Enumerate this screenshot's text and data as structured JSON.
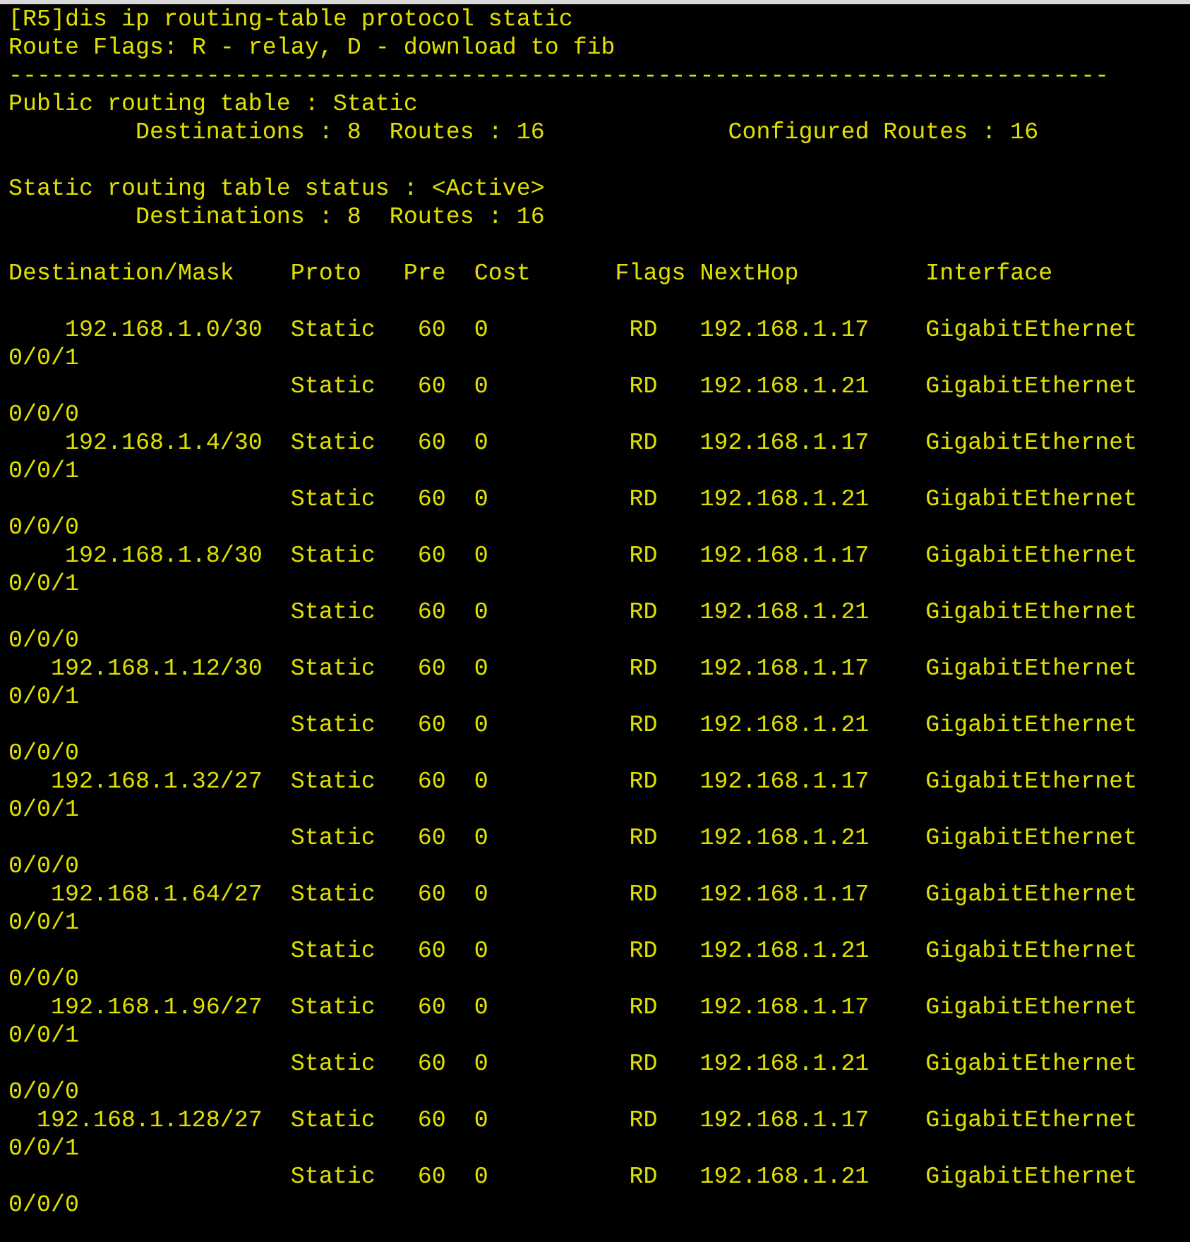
{
  "command": "[R5]dis ip routing-table protocol static",
  "flags_legend": "Route Flags: R - relay, D - download to fib",
  "separator": "------------------------------------------------------------------------------",
  "public_table": {
    "title": "Public routing table : Static",
    "destinations": "Destinations : 8",
    "routes": "Routes : 16",
    "configured_routes": "Configured Routes : 16"
  },
  "status_table": {
    "title": "Static routing table status : <Active>",
    "destinations": "Destinations : 8",
    "routes": "Routes : 16"
  },
  "table": {
    "columns": [
      "Destination/Mask",
      "Proto",
      "Pre",
      "Cost",
      "Flags",
      "NextHop",
      "Interface"
    ],
    "rows": [
      {
        "destination": "192.168.1.0/30",
        "proto": "Static",
        "pre": "60",
        "cost": "0",
        "flags": "RD",
        "nexthop": "192.168.1.17",
        "interface": "GigabitEthernet",
        "interface_wrap": "0/0/1"
      },
      {
        "proto": "Static",
        "pre": "60",
        "cost": "0",
        "flags": "RD",
        "nexthop": "192.168.1.21",
        "interface": "GigabitEthernet",
        "interface_wrap": "0/0/0"
      },
      {
        "destination": "192.168.1.4/30",
        "proto": "Static",
        "pre": "60",
        "cost": "0",
        "flags": "RD",
        "nexthop": "192.168.1.17",
        "interface": "GigabitEthernet",
        "interface_wrap": "0/0/1"
      },
      {
        "proto": "Static",
        "pre": "60",
        "cost": "0",
        "flags": "RD",
        "nexthop": "192.168.1.21",
        "interface": "GigabitEthernet",
        "interface_wrap": "0/0/0"
      },
      {
        "destination": "192.168.1.8/30",
        "proto": "Static",
        "pre": "60",
        "cost": "0",
        "flags": "RD",
        "nexthop": "192.168.1.17",
        "interface": "GigabitEthernet",
        "interface_wrap": "0/0/1"
      },
      {
        "proto": "Static",
        "pre": "60",
        "cost": "0",
        "flags": "RD",
        "nexthop": "192.168.1.21",
        "interface": "GigabitEthernet",
        "interface_wrap": "0/0/0"
      },
      {
        "destination": "192.168.1.12/30",
        "proto": "Static",
        "pre": "60",
        "cost": "0",
        "flags": "RD",
        "nexthop": "192.168.1.17",
        "interface": "GigabitEthernet",
        "interface_wrap": "0/0/1"
      },
      {
        "proto": "Static",
        "pre": "60",
        "cost": "0",
        "flags": "RD",
        "nexthop": "192.168.1.21",
        "interface": "GigabitEthernet",
        "interface_wrap": "0/0/0"
      },
      {
        "destination": "192.168.1.32/27",
        "proto": "Static",
        "pre": "60",
        "cost": "0",
        "flags": "RD",
        "nexthop": "192.168.1.17",
        "interface": "GigabitEthernet",
        "interface_wrap": "0/0/1"
      },
      {
        "proto": "Static",
        "pre": "60",
        "cost": "0",
        "flags": "RD",
        "nexthop": "192.168.1.21",
        "interface": "GigabitEthernet",
        "interface_wrap": "0/0/0"
      },
      {
        "destination": "192.168.1.64/27",
        "proto": "Static",
        "pre": "60",
        "cost": "0",
        "flags": "RD",
        "nexthop": "192.168.1.17",
        "interface": "GigabitEthernet",
        "interface_wrap": "0/0/1"
      },
      {
        "proto": "Static",
        "pre": "60",
        "cost": "0",
        "flags": "RD",
        "nexthop": "192.168.1.21",
        "interface": "GigabitEthernet",
        "interface_wrap": "0/0/0"
      },
      {
        "destination": "192.168.1.96/27",
        "proto": "Static",
        "pre": "60",
        "cost": "0",
        "flags": "RD",
        "nexthop": "192.168.1.17",
        "interface": "GigabitEthernet",
        "interface_wrap": "0/0/1"
      },
      {
        "proto": "Static",
        "pre": "60",
        "cost": "0",
        "flags": "RD",
        "nexthop": "192.168.1.21",
        "interface": "GigabitEthernet",
        "interface_wrap": "0/0/0"
      },
      {
        "destination": "192.168.1.128/27",
        "proto": "Static",
        "pre": "60",
        "cost": "0",
        "flags": "RD",
        "nexthop": "192.168.1.17",
        "interface": "GigabitEthernet",
        "interface_wrap": "0/0/1"
      },
      {
        "proto": "Static",
        "pre": "60",
        "cost": "0",
        "flags": "RD",
        "nexthop": "192.168.1.21",
        "interface": "GigabitEthernet",
        "interface_wrap": "0/0/0"
      }
    ]
  }
}
